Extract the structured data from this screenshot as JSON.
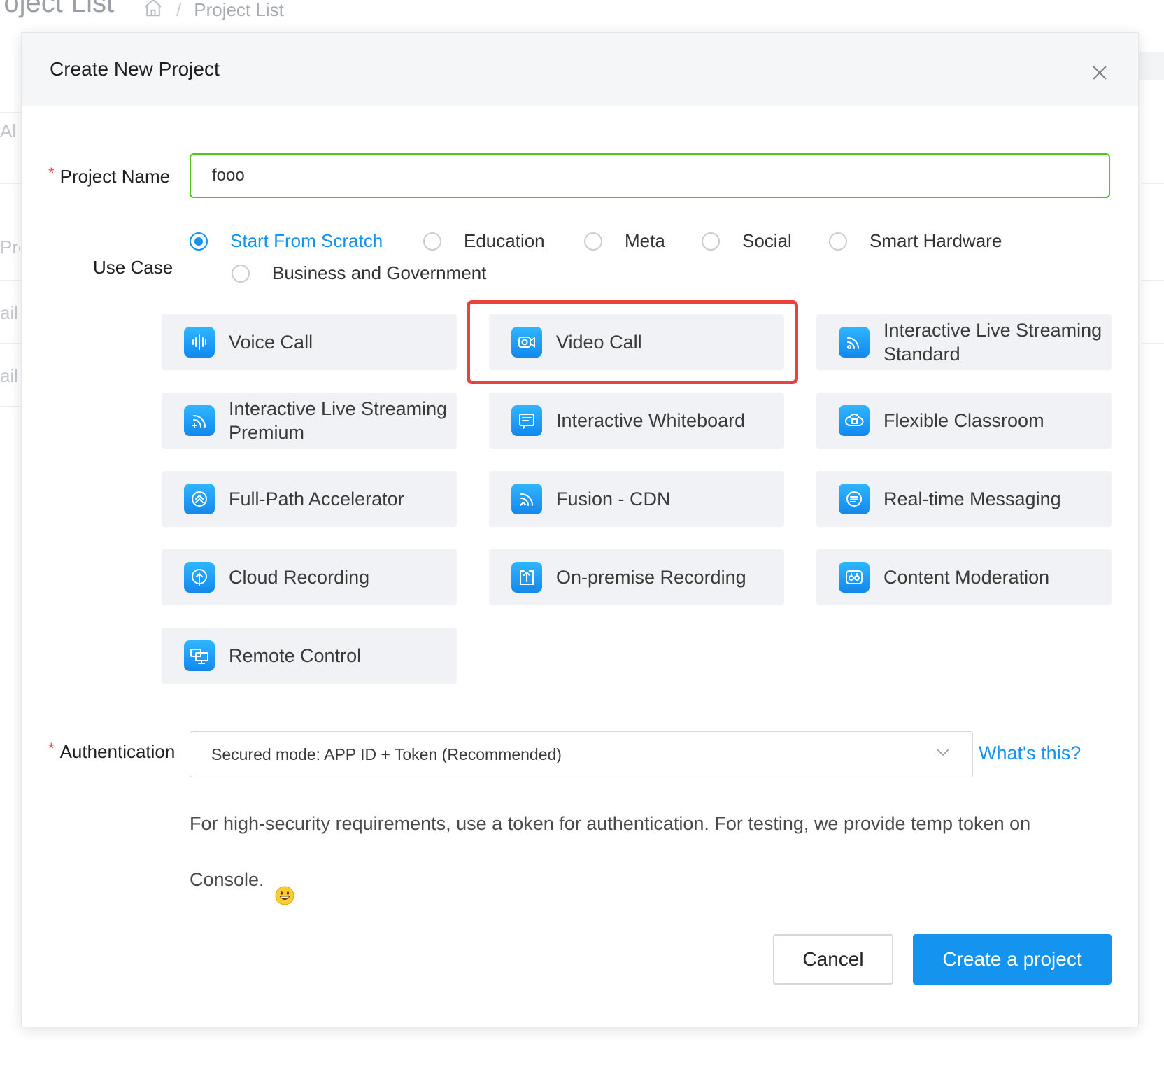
{
  "background": {
    "page_title": "roject List",
    "breadcrumb_current": "Project List",
    "fragments": [
      "Al",
      "Pro",
      "ail",
      "ail"
    ]
  },
  "modal": {
    "title": "Create New Project",
    "project_name": {
      "label": "Project Name",
      "required_mark": "*",
      "value": "fooo"
    },
    "use_case": {
      "label": "Use Case",
      "options": [
        {
          "label": "Start From Scratch",
          "checked": true
        },
        {
          "label": "Education",
          "checked": false
        },
        {
          "label": "Meta",
          "checked": false
        },
        {
          "label": "Social",
          "checked": false
        },
        {
          "label": "Smart Hardware",
          "checked": false
        },
        {
          "label": "Business and Government",
          "checked": false
        }
      ]
    },
    "products": [
      {
        "label": "Voice Call",
        "icon": "voice-wave-icon"
      },
      {
        "label": "Video Call",
        "icon": "video-camera-icon",
        "highlighted": true
      },
      {
        "label": "Interactive Live Streaming Standard",
        "icon": "broadcast-icon"
      },
      {
        "label": "Interactive Live Streaming Premium",
        "icon": "broadcast-plus-icon"
      },
      {
        "label": "Interactive Whiteboard",
        "icon": "whiteboard-icon"
      },
      {
        "label": "Flexible Classroom",
        "icon": "cloud-classroom-icon"
      },
      {
        "label": "Full-Path Accelerator",
        "icon": "accelerator-icon"
      },
      {
        "label": "Fusion - CDN",
        "icon": "cdn-icon"
      },
      {
        "label": "Real-time Messaging",
        "icon": "message-icon"
      },
      {
        "label": "Cloud Recording",
        "icon": "cloud-upload-icon"
      },
      {
        "label": "On-premise Recording",
        "icon": "upload-box-icon"
      },
      {
        "label": "Content Moderation",
        "icon": "moderation-icon"
      },
      {
        "label": "Remote Control",
        "icon": "remote-desktop-icon"
      }
    ],
    "authentication": {
      "label": "Authentication",
      "required_mark": "*",
      "selected": "Secured mode: APP ID + Token (Recommended)",
      "help_link": "What's this?",
      "help_text": "For high-security requirements, use a token for authentication. For testing, we provide temp token on Console."
    },
    "buttons": {
      "cancel": "Cancel",
      "create": "Create a project"
    },
    "colors": {
      "primary": "#1493ef",
      "valid_border": "#52c41a",
      "highlight": "#e8433d"
    }
  }
}
